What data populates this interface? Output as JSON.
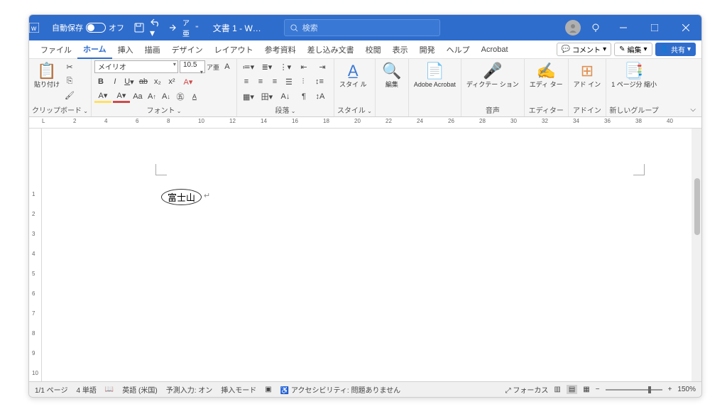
{
  "titlebar": {
    "autosave_label": "自動保存",
    "autosave_state": "オフ",
    "doc_title": "文書 1 - W…",
    "search_placeholder": "検索"
  },
  "tabs": {
    "items": [
      "ファイル",
      "ホーム",
      "挿入",
      "描画",
      "デザイン",
      "レイアウト",
      "参考資料",
      "差し込み文書",
      "校閲",
      "表示",
      "開発",
      "ヘルプ",
      "Acrobat"
    ],
    "active": 1,
    "comments": "コメント",
    "editing": "編集",
    "share": "共有"
  },
  "ribbon": {
    "clipboard": {
      "paste": "貼り付け",
      "label": "クリップボード"
    },
    "font": {
      "name": "メイリオ",
      "size": "10.5",
      "label": "フォント"
    },
    "paragraph": {
      "label": "段落"
    },
    "styles": {
      "btn": "スタイ\nル",
      "label": "スタイル"
    },
    "editing": {
      "btn": "編集",
      "label": ""
    },
    "acrobat": {
      "btn": "Adobe\nAcrobat",
      "label": ""
    },
    "dictation": {
      "btn": "ディクテー\nション",
      "label": "音声"
    },
    "editor": {
      "btn": "エディ\nター",
      "label": "エディター"
    },
    "addin": {
      "btn": "アド\nイン",
      "label": "アドイン"
    },
    "newgroup": {
      "btn": "1 ページ分\n縮小",
      "label": "新しいグループ"
    }
  },
  "document": {
    "text": "富士山"
  },
  "statusbar": {
    "page": "1/1 ページ",
    "words": "4 単語",
    "lang": "英語 (米国)",
    "predict": "予測入力: オン",
    "insert": "挿入モード",
    "access": "アクセシビリティ: 問題ありません",
    "focus": "フォーカス",
    "zoom": "150%"
  },
  "ruler": {
    "h": [
      "L",
      "2",
      "4",
      "6",
      "8",
      "10",
      "12",
      "14",
      "16",
      "18",
      "20",
      "22",
      "24",
      "26",
      "28",
      "30",
      "32",
      "34",
      "36",
      "38",
      "40"
    ],
    "v": [
      "",
      "",
      "",
      "1",
      "2",
      "3",
      "4",
      "5",
      "6",
      "7",
      "8",
      "9",
      "10"
    ]
  }
}
